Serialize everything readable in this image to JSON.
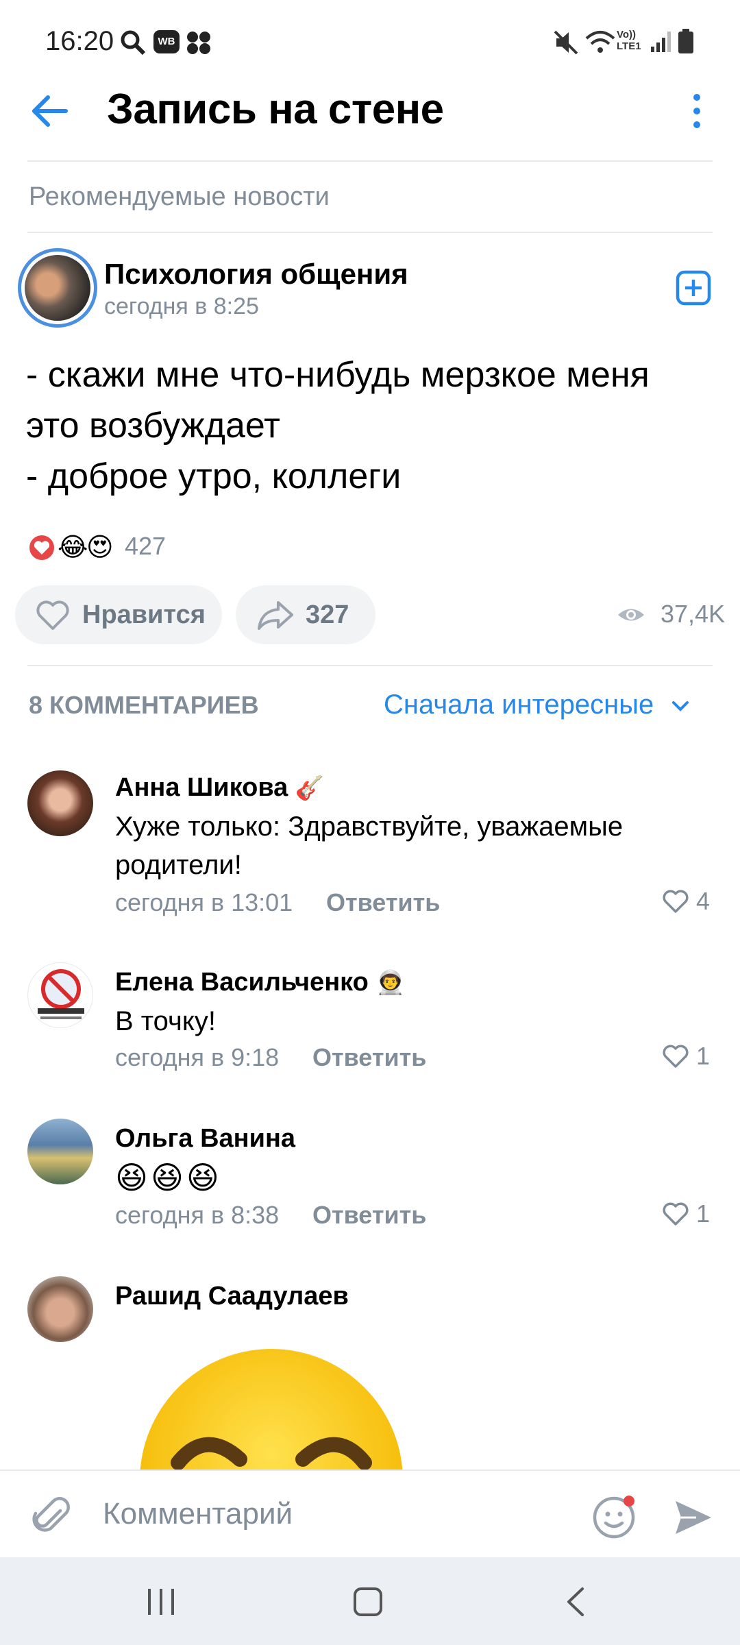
{
  "status_bar": {
    "time": "16:20",
    "network": "Vo)) LTE1"
  },
  "header": {
    "title": "Запись на стене"
  },
  "section_label": "Рекомендуемые новости",
  "post": {
    "group_name": "Психология общения",
    "time": "сегодня в 8:25",
    "text": "- скажи мне что-нибудь мерзкое меня\nэто возбуждает\n- доброе утро, коллеги",
    "reactions_count": "427",
    "like_label": "Нравится",
    "share_count": "327",
    "views": "37,4K"
  },
  "comments_header": {
    "count_label": "8 КОММЕНТАРИЕВ",
    "sort_label": "Сначала интересные"
  },
  "comments": [
    {
      "author": "Анна Шикова",
      "text": "Хуже только: Здравствуйте, уважаемые родители!",
      "time": "сегодня в 13:01",
      "reply": "Ответить",
      "likes": "4"
    },
    {
      "author": "Елена Васильченко",
      "text": "В точку!",
      "time": "сегодня в 9:18",
      "reply": "Ответить",
      "likes": "1"
    },
    {
      "author": "Ольга Ванина",
      "text": "😆😆😆",
      "time": "сегодня в 8:38",
      "reply": "Ответить",
      "likes": "1"
    },
    {
      "author": "Рашид Саадулаев"
    }
  ],
  "composer": {
    "placeholder": "Комментарий"
  },
  "colors": {
    "accent": "#2688eb",
    "secondary_text": "#818c99",
    "like_red": "#e64646"
  }
}
